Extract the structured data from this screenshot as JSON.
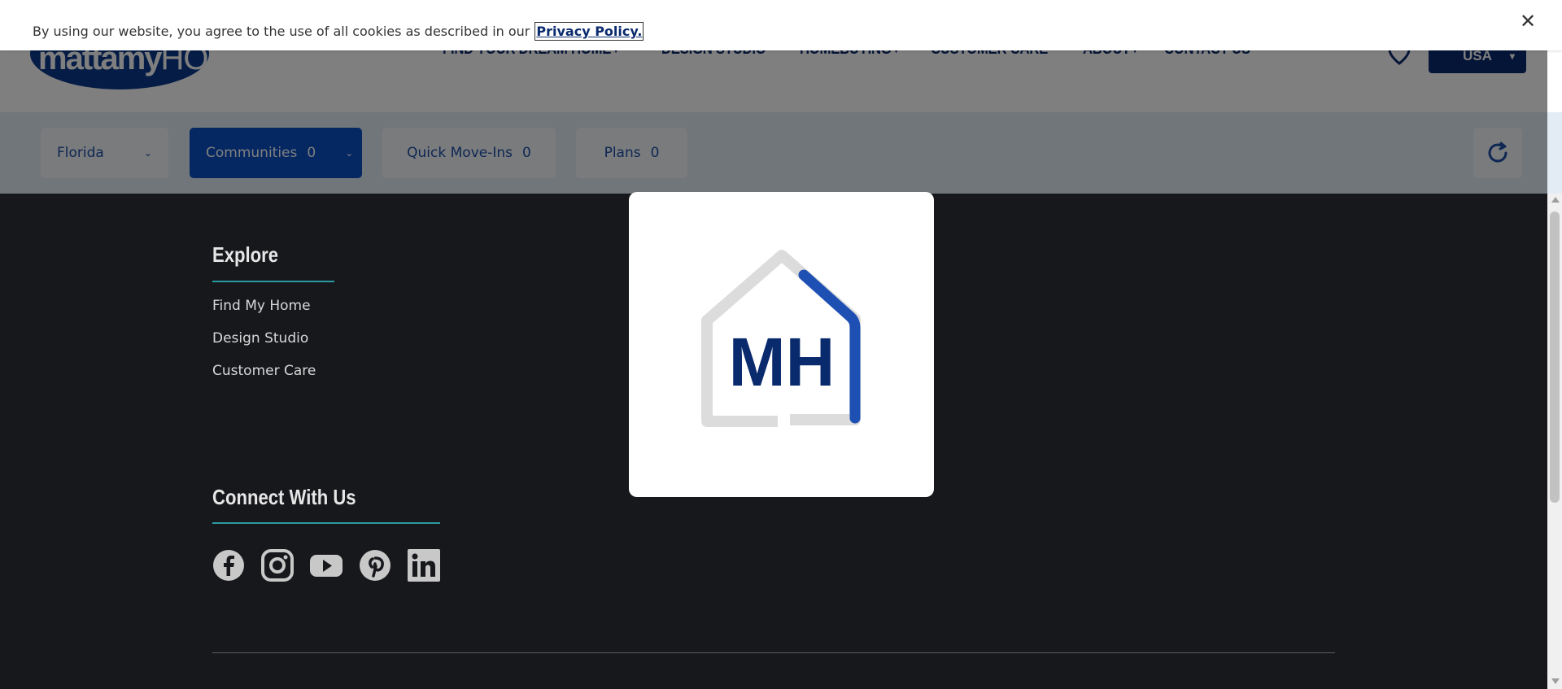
{
  "cookie_banner": {
    "text": "By using our website, you agree to the use of all cookies as described in our",
    "link_label": "Privacy Policy.",
    "close_label": "✕"
  },
  "header": {
    "logo_text_bold": "mattamy",
    "logo_text_light": "HOMES",
    "nav": [
      {
        "label": "FIND YOUR DREAM HOME",
        "has_dropdown": true
      },
      {
        "label": "DESIGN STUDIO",
        "has_dropdown": false
      },
      {
        "label": "HOMEBUYING",
        "has_dropdown": true
      },
      {
        "label": "CUSTOMER CARE",
        "has_dropdown": false
      },
      {
        "label": "ABOUT",
        "has_dropdown": true
      },
      {
        "label": "CONTACT US",
        "has_dropdown": false
      }
    ],
    "country_label": "USA",
    "heart_icon": "heart-icon"
  },
  "filters": {
    "state": "Florida",
    "communities_label": "Communities",
    "communities_count": "0",
    "quick_move_ins_label": "Quick Move-Ins",
    "quick_move_ins_count": "0",
    "plans_label": "Plans",
    "plans_count": "0",
    "refresh_icon": "refresh-icon"
  },
  "loader": {
    "monogram": "MH",
    "house_grey": "#dcdcdc",
    "house_blue": "#1e50b4",
    "monogram_color": "#0a2a6e"
  },
  "footer": {
    "explore_heading": "Explore",
    "explore_links": [
      "Find My Home",
      "Design Studio",
      "Customer Care"
    ],
    "connect_heading": "Connect With Us",
    "socials": [
      "facebook-icon",
      "instagram-icon",
      "youtube-icon",
      "pinterest-icon",
      "linkedin-icon"
    ]
  },
  "colors": {
    "brand_navy": "#0a2a6e",
    "brand_blue": "#0a4ec4",
    "footer_bg": "#17181c",
    "accent_teal": "#2a9ba0"
  }
}
